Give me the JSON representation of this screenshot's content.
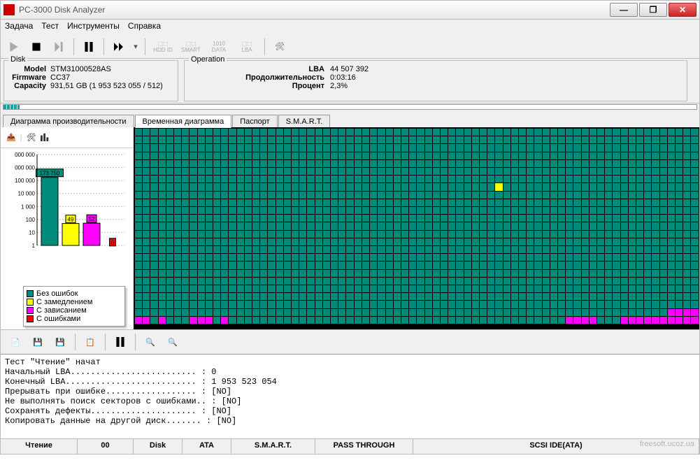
{
  "window": {
    "title": "PC-3000 Disk Analyzer"
  },
  "menu": {
    "task": "Задача",
    "test": "Тест",
    "tools": "Инструменты",
    "help": "Справка"
  },
  "toolbarLabels": {
    "hddid": "HDD ID",
    "smart": "SMART",
    "data": "DATA",
    "lba": "LBA"
  },
  "disk": {
    "legend": "Disk",
    "model_lbl": "Model",
    "model": "STM31000528AS",
    "fw_lbl": "Firmware",
    "fw": "CC37",
    "cap_lbl": "Capacity",
    "cap": "931,51 GB (1 953 523 055 / 512)"
  },
  "op": {
    "legend": "Operation",
    "lba_lbl": "LBA",
    "lba": "44 507 392",
    "dur_lbl": "Продолжительность",
    "dur": "0:03:16",
    "pct_lbl": "Процент",
    "pct": "2,3%"
  },
  "tabs": {
    "perf": "Диаграмма производительности",
    "time": "Временная диаграмма",
    "passport": "Паспорт",
    "smart": "S.M.A.R.T."
  },
  "chart_data": {
    "type": "bar",
    "yscale": "log",
    "yticks": [
      "1",
      "10",
      "100",
      "1 000",
      "10 000",
      "100 000",
      "000 000",
      "000 000"
    ],
    "series": [
      {
        "name": "Без ошибок",
        "color": "#008b7a",
        "value": 173750,
        "label": "173 750"
      },
      {
        "name": "С замедлением",
        "color": "#ffff00",
        "value": 49,
        "label": "49"
      },
      {
        "name": "С зависанием",
        "color": "#ff00ff",
        "value": 52,
        "label": "52"
      },
      {
        "name": "С ошибками",
        "color": "#ff0000",
        "value": 0,
        "label": "0"
      }
    ]
  },
  "legend": {
    "ok": "Без ошибок",
    "slow": "С замедлением",
    "hang": "С зависанием",
    "err": "С ошибками"
  },
  "log": {
    "lines": [
      "Тест \"Чтение\" начат",
      "Начальный LBA......................... : 0",
      "Конечный LBA.......................... : 1 953 523 054",
      "Прерывать при ошибке.................. : [NO]",
      "Не выполнять поиск секторов с ошибками.. : [NO]",
      "Сохранять дефекты..................... : [NO]",
      "Копировать данные на другой диск....... : [NO]"
    ]
  },
  "status": {
    "read": "Чтение",
    "zz": "00",
    "disk": "Disk",
    "ata": "ATA",
    "smart": "S.M.A.R.T.",
    "pt": "PASS THROUGH",
    "scsi": "SCSI IDE(ATA)"
  },
  "watermark": "freesoft.ucoz.ua"
}
